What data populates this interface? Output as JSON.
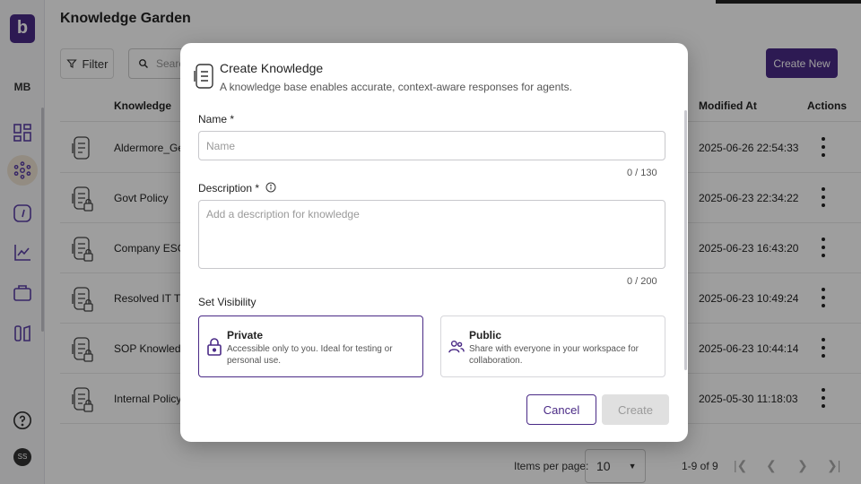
{
  "app": {
    "logo_letter": "b",
    "workspace_initials": "MB",
    "user_initials": "SS",
    "page_title": "Knowledge Garden"
  },
  "toolbar": {
    "filter_label": "Filter",
    "search_placeholder": "Search",
    "create_new_label": "Create New"
  },
  "table": {
    "columns": [
      "Knowledge",
      "Modified At",
      "Actions"
    ],
    "rows": [
      {
        "name": "Aldermore_General",
        "modified": "2025-06-26 22:54:33",
        "locked": false
      },
      {
        "name": "Govt Policy",
        "modified": "2025-06-23 22:34:22",
        "locked": true
      },
      {
        "name": "Company ESG Data",
        "modified": "2025-06-23 16:43:20",
        "locked": true
      },
      {
        "name": "Resolved IT Tickets",
        "modified": "2025-06-23 10:49:24",
        "locked": true
      },
      {
        "name": "SOP Knowledge",
        "modified": "2025-06-23 10:44:14",
        "locked": true
      },
      {
        "name": "Internal Policy Knowledge",
        "modified": "2025-05-30 11:18:03",
        "locked": true
      }
    ]
  },
  "pagination": {
    "items_per_page_label": "Items per page:",
    "items_per_page_value": "10",
    "range_label": "1-9 of 9"
  },
  "modal": {
    "title": "Create Knowledge",
    "subtitle": "A knowledge base enables accurate, context-aware responses for agents.",
    "name_label": "Name *",
    "name_placeholder": "Name",
    "name_counter": "0 / 130",
    "description_label": "Description *",
    "description_placeholder": "Add a description for knowledge",
    "description_counter": "0 / 200",
    "visibility_label": "Set Visibility",
    "visibility_options": [
      {
        "title": "Private",
        "description": "Accessible only to you. Ideal for testing or personal use.",
        "selected": true
      },
      {
        "title": "Public",
        "description": "Share with everyone in your workspace for collaboration.",
        "selected": false
      }
    ],
    "cancel_label": "Cancel",
    "create_label": "Create"
  },
  "colors": {
    "brand": "#4a2a86",
    "overlay": "rgba(0,0,0,0.38)"
  }
}
